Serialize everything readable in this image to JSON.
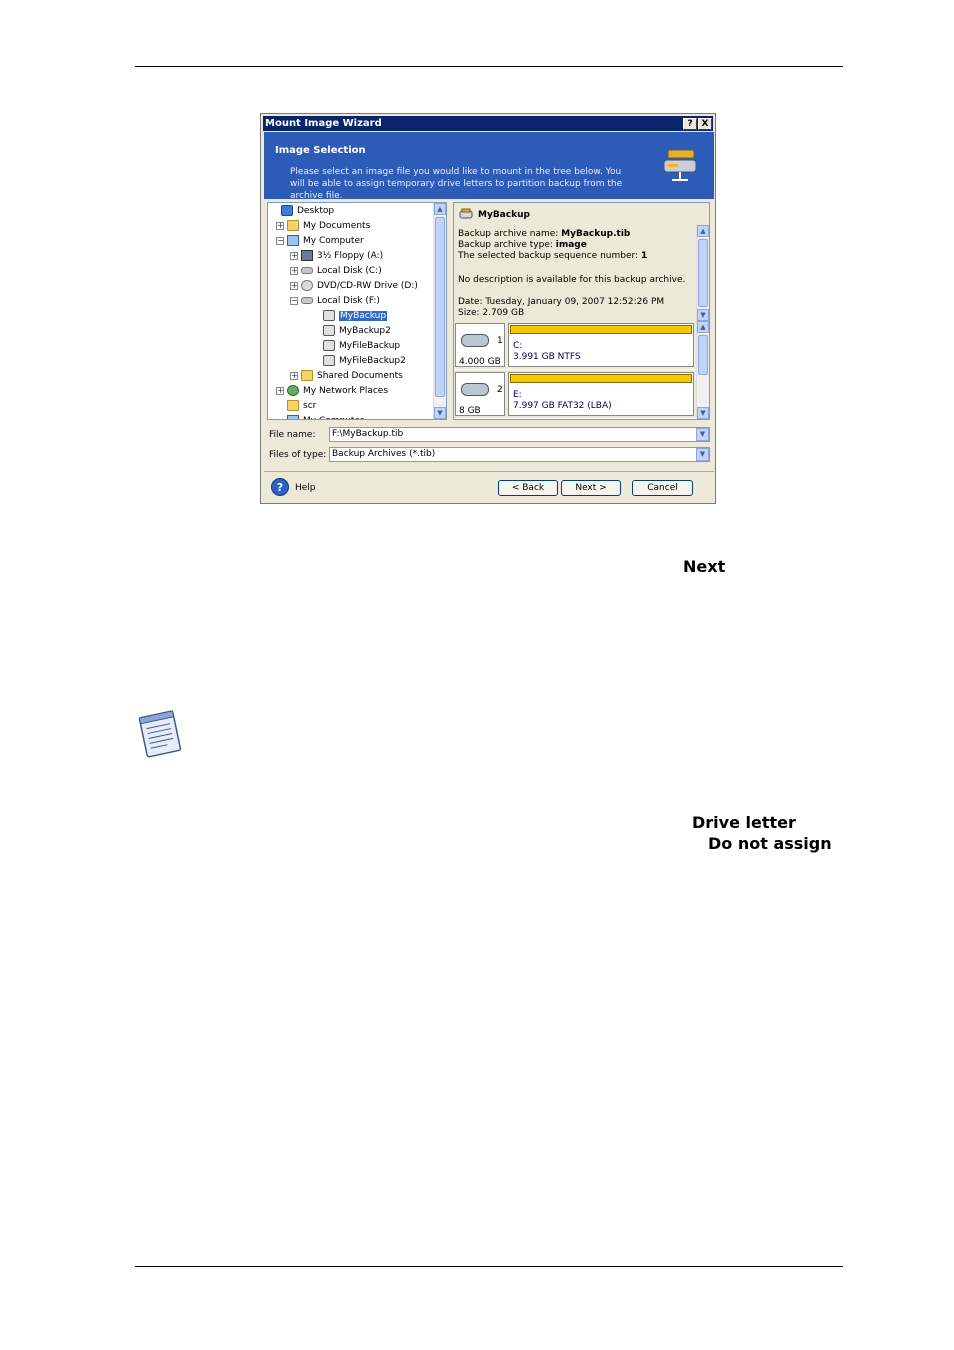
{
  "dialog": {
    "title": "Mount Image Wizard",
    "title_buttons": {
      "help": "?",
      "close": "X"
    },
    "header": {
      "title": "Image Selection",
      "description": "Please select an image file you would like to mount in the tree below. You will be able to assign temporary drive letters to partition backup from the archive file."
    },
    "tree": {
      "items": [
        {
          "label": "Desktop",
          "expander": "",
          "icon": "desk"
        },
        {
          "label": "My Documents",
          "expander": "+",
          "icon": "folder"
        },
        {
          "label": "My Computer",
          "expander": "−",
          "icon": "pc"
        },
        {
          "label": "3½ Floppy (A:)",
          "expander": "+",
          "icon": "floppy"
        },
        {
          "label": "Local Disk (C:)",
          "expander": "+",
          "icon": "drive"
        },
        {
          "label": "DVD/CD-RW Drive (D:)",
          "expander": "+",
          "icon": "disc"
        },
        {
          "label": "Local Disk (F:)",
          "expander": "−",
          "icon": "drive"
        },
        {
          "label": "MyBackup",
          "expander": "",
          "icon": "archive",
          "selected": true
        },
        {
          "label": "MyBackup2",
          "expander": "",
          "icon": "archive"
        },
        {
          "label": "MyFileBackup",
          "expander": "",
          "icon": "archive"
        },
        {
          "label": "MyFileBackup2",
          "expander": "",
          "icon": "archive"
        },
        {
          "label": "Shared Documents",
          "expander": "+",
          "icon": "folder"
        },
        {
          "label": "My Network Places",
          "expander": "+",
          "icon": "net"
        },
        {
          "label": "scr",
          "expander": "",
          "icon": "folder"
        },
        {
          "label": "My Computer",
          "expander": "",
          "icon": "pc"
        }
      ]
    },
    "info": {
      "title": "MyBackup",
      "archive_name_label": "Backup archive name: ",
      "archive_name": "MyBackup.tib",
      "archive_type_label": "Backup archive type: ",
      "archive_type": "image",
      "sequence_label": "The selected backup sequence number: ",
      "sequence": "1",
      "description": "No description is available for this backup archive.",
      "date": "Date: Tuesday, January 09, 2007 12:52:26 PM",
      "size": "Size: 2.709 GB",
      "disks": [
        {
          "number": "1",
          "size": "4.000 GB",
          "letter": "C:",
          "detail": "3.991 GB  NTFS"
        },
        {
          "number": "2",
          "size": "8 GB",
          "letter": "E:",
          "detail": "7.997 GB  FAT32 (LBA)"
        }
      ]
    },
    "file_name_label": "File name:",
    "file_name": "F:\\MyBackup.tib",
    "files_of_type_label": "Files of type:",
    "files_of_type": "Backup Archives (*.tib)",
    "buttons": {
      "help": "Help",
      "back": "< Back",
      "next": "Next >",
      "cancel": "Cancel"
    },
    "icons": {
      "help": "?",
      "scroll_up": "▲",
      "scroll_down": "▼",
      "drop": "▼"
    }
  },
  "page": {
    "word_next": "Next",
    "word_drive_letter": "Drive letter",
    "word_do_not_assign": "Do not assign"
  }
}
